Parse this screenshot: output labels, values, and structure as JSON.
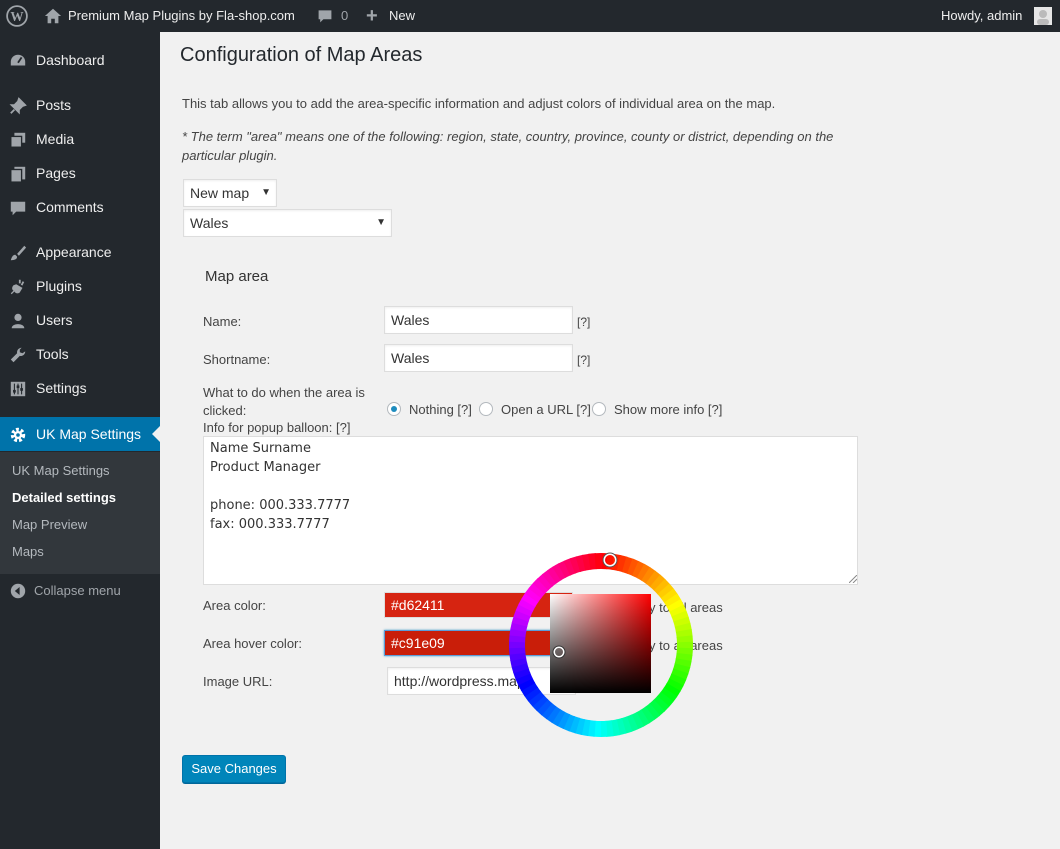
{
  "adminbar": {
    "site_title": "Premium Map Plugins by Fla-shop.com",
    "comments_count": "0",
    "new_label": "New",
    "howdy": "Howdy, admin"
  },
  "sidebar": {
    "items": [
      {
        "label": "Dashboard",
        "icon": "dashboard-icon"
      },
      {
        "label": "Posts",
        "icon": "pin-icon"
      },
      {
        "label": "Media",
        "icon": "media-icon"
      },
      {
        "label": "Pages",
        "icon": "pages-icon"
      },
      {
        "label": "Comments",
        "icon": "comment-icon"
      },
      {
        "label": "Appearance",
        "icon": "brush-icon"
      },
      {
        "label": "Plugins",
        "icon": "plug-icon"
      },
      {
        "label": "Users",
        "icon": "user-icon"
      },
      {
        "label": "Tools",
        "icon": "wrench-icon"
      },
      {
        "label": "Settings",
        "icon": "sliders-icon"
      },
      {
        "label": "UK Map Settings",
        "icon": "gear-icon"
      }
    ],
    "submenu": [
      "UK Map Settings",
      "Detailed settings",
      "Map Preview",
      "Maps"
    ],
    "collapse": "Collapse menu"
  },
  "main": {
    "title": "Configuration of Map Areas",
    "intro": "This tab allows you to add the area-specific information and adjust colors of individual area on the map.",
    "note": "* The term \"area\" means one of the following: region, state, country, province, county or district, depending on the particular plugin.",
    "map_select": "New map",
    "area_select": "Wales",
    "fieldset_legend": "Map area",
    "name_label": "Name:",
    "name_value": "Wales",
    "shortname_label": "Shortname:",
    "shortname_value": "Wales",
    "help": "[?]",
    "click_label": "What to do when the area is clicked:",
    "click_options": [
      "Nothing [?]",
      "Open a URL [?]",
      "Show more info [?]"
    ],
    "popup_label": "Info for popup balloon: [?]",
    "popup_value": "Name Surname\nProduct Manager\n\nphone: 000.333.7777\nfax: 000.333.7777",
    "area_color_label": "Area color:",
    "area_color_value": "#d62411",
    "area_hover_label": "Area hover color:",
    "area_hover_value": "#c91e09",
    "apply_all_1": "Apply to all areas",
    "apply_all_2": "Apply to all areas",
    "image_url_label": "Image URL:",
    "image_url_value": "http://wordpress.map",
    "save_button": "Save Changes"
  },
  "colors": {
    "area_color": "#d62411",
    "area_hover_color": "#c91e09",
    "accent": "#0073aa"
  }
}
